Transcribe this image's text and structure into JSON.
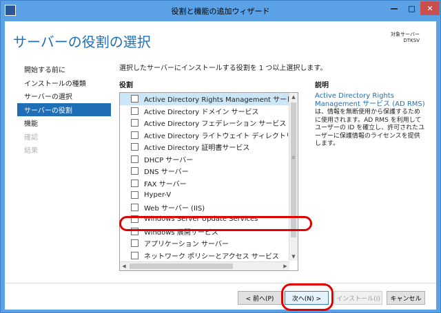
{
  "window": {
    "title": "役割と機能の追加ウィザード",
    "min_glyph": "—",
    "max_glyph": "□",
    "close_glyph": "✕"
  },
  "header": {
    "heading": "サーバーの役割の選択",
    "target_label": "対象サーバー",
    "target_name": "DTKSV"
  },
  "nav": {
    "items": [
      {
        "label": "開始する前に",
        "state": "normal"
      },
      {
        "label": "インストールの種類",
        "state": "normal"
      },
      {
        "label": "サーバーの選択",
        "state": "normal"
      },
      {
        "label": "サーバーの役割",
        "state": "selected"
      },
      {
        "label": "機能",
        "state": "normal"
      },
      {
        "label": "確認",
        "state": "disabled"
      },
      {
        "label": "結果",
        "state": "disabled"
      }
    ]
  },
  "main": {
    "instruction": "選択したサーバーにインストールする役割を 1 つ以上選択します。",
    "roles_label": "役割",
    "description_label": "説明",
    "roles": [
      {
        "label": "Active Directory Rights Management サービス",
        "checked": false,
        "highlighted": true,
        "expandable": false
      },
      {
        "label": "Active Directory ドメイン サービス",
        "checked": false,
        "highlighted": false,
        "expandable": false
      },
      {
        "label": "Active Directory フェデレーション サービス",
        "checked": false,
        "highlighted": false,
        "expandable": false
      },
      {
        "label": "Active Directory ライトウェイト ディレクトリ サービス",
        "checked": false,
        "highlighted": false,
        "expandable": false
      },
      {
        "label": "Active Directory 証明書サービス",
        "checked": false,
        "highlighted": false,
        "expandable": false
      },
      {
        "label": "DHCP サーバー",
        "checked": false,
        "highlighted": false,
        "expandable": false
      },
      {
        "label": "DNS サーバー",
        "checked": false,
        "highlighted": false,
        "expandable": false
      },
      {
        "label": "FAX サーバー",
        "checked": false,
        "highlighted": false,
        "expandable": false
      },
      {
        "label": "Hyper-V",
        "checked": false,
        "highlighted": false,
        "expandable": false
      },
      {
        "label": "Web サーバー (IIS)",
        "checked": false,
        "highlighted": false,
        "expandable": false
      },
      {
        "label": "Windows Server Update Services",
        "checked": false,
        "highlighted": false,
        "expandable": false
      },
      {
        "label": "Windows 展開サービス",
        "checked": false,
        "highlighted": false,
        "expandable": false
      },
      {
        "label": "アプリケーション サーバー",
        "checked": false,
        "highlighted": false,
        "expandable": false
      },
      {
        "label": "ネットワーク ポリシーとアクセス サービス",
        "checked": false,
        "highlighted": false,
        "expandable": false
      }
    ],
    "description_title": "Active Directory Rights Management サービス (AD RMS)",
    "description_body": "は、情報を無断使用から保護するために使用されます。AD RMS を利用してユーザーの ID を確立し、許可されたユーザーに保護情報のライセンスを提供します。"
  },
  "footer": {
    "prev_label": "< 前へ(P)",
    "next_label": "次へ(N) >",
    "install_label": "インストール(I)",
    "cancel_label": "キャンセル"
  },
  "colors": {
    "titlebar": "#5aa1e5",
    "accent": "#1e6fb5",
    "close": "#c7504c",
    "annotation": "#e00000"
  }
}
